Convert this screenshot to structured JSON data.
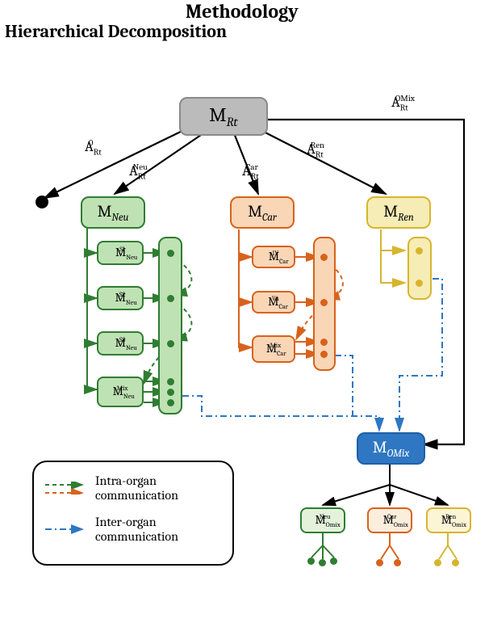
{
  "title": "Methodology",
  "subtitle": "Hierarchical Decomposition",
  "root": {
    "label": "M",
    "sub": "Rt"
  },
  "edges": {
    "a0": {
      "pre": "A",
      "sub": "Rt",
      "sup": "0"
    },
    "aNeu": {
      "pre": "A",
      "sub": "Rt",
      "sup": "Neu"
    },
    "aCar": {
      "pre": "A",
      "sub": "Rt",
      "sup": "Car"
    },
    "aRen": {
      "pre": "A",
      "sub": "Rt",
      "sup": "Ren"
    },
    "aOMix": {
      "pre": "A",
      "sub": "Rt",
      "sup": "OMix"
    }
  },
  "neu": {
    "label": {
      "pre": "M",
      "sub": "Neu"
    },
    "children": [
      {
        "pre": "M",
        "sub": "Neu",
        "sup": "S1"
      },
      {
        "pre": "M",
        "sub": "Neu",
        "sup": "S2"
      },
      {
        "pre": "M",
        "sub": "Neu",
        "sup": "S3"
      },
      {
        "pre": "M",
        "sub": "Neu",
        "sup": "Mix"
      }
    ]
  },
  "car": {
    "label": {
      "pre": "M",
      "sub": "Car"
    },
    "children": [
      {
        "pre": "M",
        "sub": "Car",
        "sup": "IV"
      },
      {
        "pre": "M",
        "sub": "Car",
        "sup": "VA"
      },
      {
        "pre": "M",
        "sub": "Car",
        "sup": "Mix"
      }
    ]
  },
  "ren": {
    "label": {
      "pre": "M",
      "sub": "Ren"
    }
  },
  "omix": {
    "label": {
      "pre": "M",
      "sub": "OMix"
    },
    "children": [
      {
        "pre": "M",
        "sub": "Omix",
        "sup": "Neu"
      },
      {
        "pre": "M",
        "sub": "Omix",
        "sup": "Car"
      },
      {
        "pre": "M",
        "sub": "Omix",
        "sup": "Ren"
      }
    ]
  },
  "legend": {
    "intra": "Intra-organ communication",
    "inter": "Inter-organ communication"
  },
  "colors": {
    "neu": "#2f7d32",
    "car": "#d8621c",
    "ren": "#d7b52e",
    "omix": "#1f5fa8",
    "root": "#8a8a8a",
    "blue": "#2f77c2"
  }
}
